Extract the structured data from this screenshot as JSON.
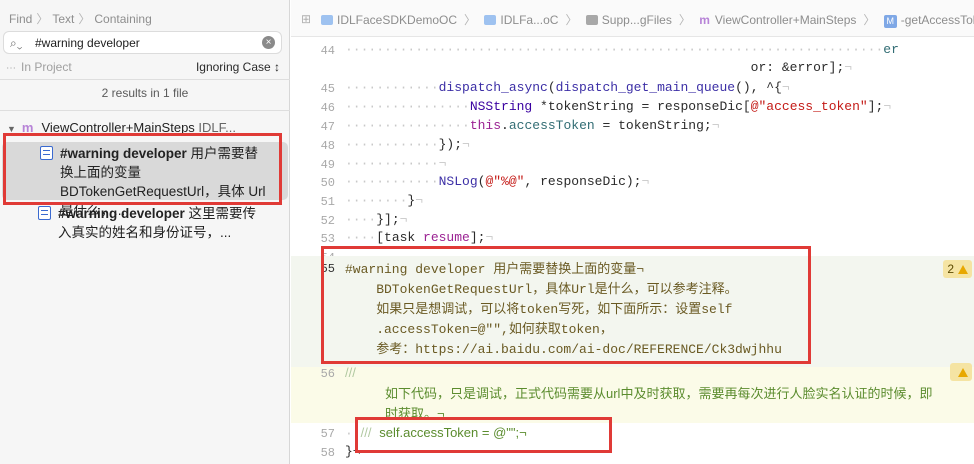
{
  "find_nav": {
    "breadcrumb": [
      "Find",
      "Text",
      "Containing"
    ],
    "query": "#warning developer",
    "scope": "In Project",
    "matching": "Ignoring Case ↕",
    "summary": "2 results in 1 file",
    "file": {
      "icon": "m",
      "name": "ViewController+MainSteps",
      "rest": "IDLF..."
    },
    "results": [
      {
        "match": "#warning developer",
        "text": " 用户需要替换上面的变量 BDTokenGetRequestUrl，具体 Url是什么，..."
      },
      {
        "match": "#warning developer",
        "text": " 这里需要传入真实的姓名和身份证号，..."
      }
    ]
  },
  "jump_bar": {
    "items": [
      "IDLFaceSDKDemoOC",
      "IDLFa...oC",
      "Supp...gFiles",
      "ViewController+MainSteps",
      "-getAccessToke"
    ],
    "file_icon": "m",
    "method_icon": "M"
  },
  "editor": {
    "lines": [
      {
        "n": "44",
        "html": "<span class='dots'>·····································································</span><span class='prop'>er</span>"
      },
      {
        "n": "",
        "html": "<span class='dots'>                                                    </span>or: &amp;error];<span class='dots'>¬</span>"
      },
      {
        "n": "45",
        "html": "<span class='dots'>············</span><span class='fn'>dispatch_async</span>(<span class='fn'>dispatch_get_main_queue</span>(), ^{<span class='dots'>¬</span>"
      },
      {
        "n": "46",
        "html": "<span class='dots'>················</span><span class='cls'>NSString</span> *tokenString = responseDic[<span class='str'>@\"access_token\"</span>];<span class='dots'>¬</span>"
      },
      {
        "n": "47",
        "html": "<span class='dots'>················</span><span class='kw'>this</span>.<span class='prop'>accessToken</span> = tokenString;<span class='dots'>¬</span>"
      },
      {
        "n": "48",
        "html": "<span class='dots'>············</span>});<span class='dots'>¬</span>"
      },
      {
        "n": "49",
        "html": "<span class='dots'>············¬</span>"
      },
      {
        "n": "50",
        "html": "<span class='dots'>············</span><span class='fn'>NSLog</span>(<span class='str'>@\"%@\"</span>, responseDic);<span class='dots'>¬</span>"
      },
      {
        "n": "51",
        "html": "<span class='dots'>········</span>}<span class='dots'>¬</span>"
      },
      {
        "n": "52",
        "html": "<span class='dots'>····</span>}];<span class='dots'>¬</span>"
      },
      {
        "n": "53",
        "html": "<span class='dots'>····</span>[task <span class='kw'>resume</span>];<span class='dots'>¬</span>"
      },
      {
        "n": "54",
        "html": ""
      }
    ],
    "warning": {
      "n": "55",
      "lines": [
        "#warning developer 用户需要替换上面的变量¬",
        "    BDTokenGetRequestUrl，具体Url是什么，可以参考注释。",
        "    如果只是想调试，可以将token写死，如下面所示：设置self",
        "    .accessToken=@\"\",如何获取token，",
        "    参考：https://ai.baidu.com/ai-doc/REFERENCE/Ck3dwjhhu"
      ],
      "badge_count": "2"
    },
    "note": {
      "n": "56",
      "prefix": "///",
      "lines": [
        "如下代码，只是调试，正式代码需要从url中及时获取，需要再每次进行人脸实名认证的时候，即",
        "时获取。¬"
      ]
    },
    "line57": {
      "n": "57",
      "prefix": "///",
      "code": "self.accessToken = @\"\";¬"
    },
    "line58": {
      "n": "58",
      "code": "}¬"
    }
  },
  "colors": {
    "highlight": "#e03a36",
    "warning_badge": "#f5e4a3"
  }
}
